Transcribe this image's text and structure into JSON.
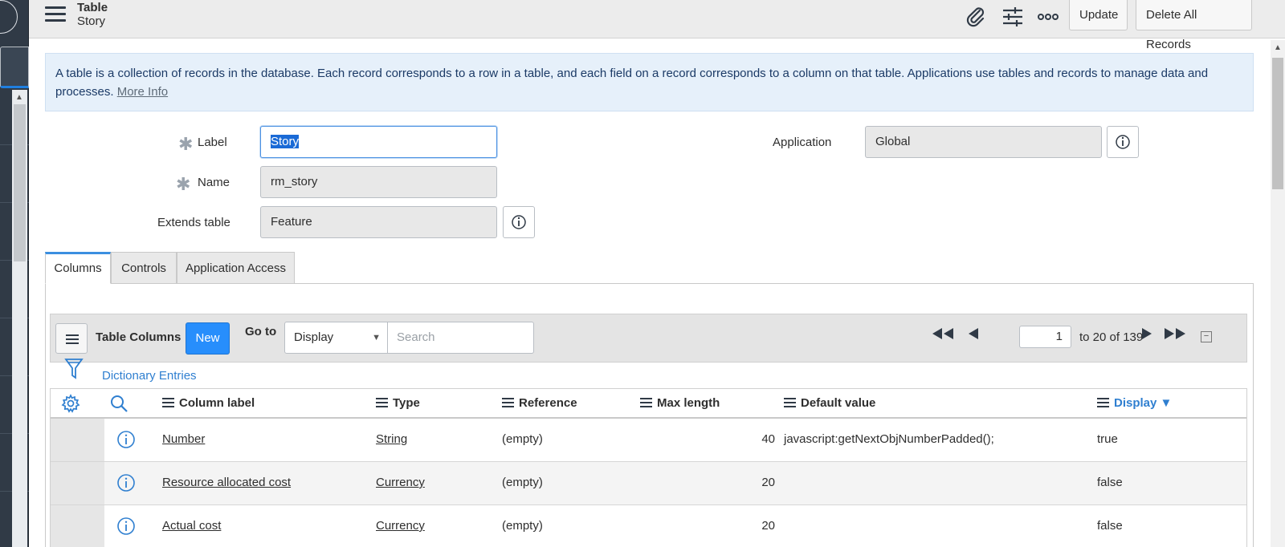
{
  "header": {
    "title": "Table",
    "subtitle": "Story",
    "icons": [
      "paperclip-icon",
      "sliders-icon",
      "more-icon"
    ],
    "update_label": "Update",
    "delete_all_label": "Delete All Records"
  },
  "banner": {
    "text": "A table is a collection of records in the database. Each record corresponds to a row in a table, and each field on a record corresponds to a column on that table. Applications use tables and records to manage data and processes.",
    "link": "More Info"
  },
  "form": {
    "label_label": "Label",
    "label_value": "Story",
    "name_label": "Name",
    "name_value": "rm_story",
    "extends_label": "Extends table",
    "extends_value": "Feature",
    "application_label": "Application",
    "application_value": "Global"
  },
  "tabs": [
    "Columns",
    "Controls",
    "Application Access"
  ],
  "list": {
    "title": "Table Columns",
    "new_label": "New",
    "goto_label": "Go to",
    "goto_field": "Display",
    "search_placeholder": "Search",
    "page_input": "1",
    "page_text": "to 20 of 139",
    "filter_link": "Dictionary Entries"
  },
  "table": {
    "columns": [
      "Column label",
      "Type",
      "Reference",
      "Max length",
      "Default value",
      "Display"
    ],
    "sorted_column": "Display",
    "rows": [
      {
        "label": "Number",
        "type": "String",
        "reference": "(empty)",
        "max_length": "40",
        "default": "javascript:getNextObjNumberPadded();",
        "display": "true"
      },
      {
        "label": "Resource allocated cost",
        "type": "Currency",
        "reference": "(empty)",
        "max_length": "20",
        "default": "",
        "display": "false"
      },
      {
        "label": "Actual cost",
        "type": "Currency",
        "reference": "(empty)",
        "max_length": "20",
        "default": "",
        "display": "false"
      }
    ]
  },
  "colors": {
    "accent": "#278efc",
    "link": "#2f7fd0",
    "banner_bg": "#e6f0fa",
    "nav_bg": "#303a46"
  }
}
